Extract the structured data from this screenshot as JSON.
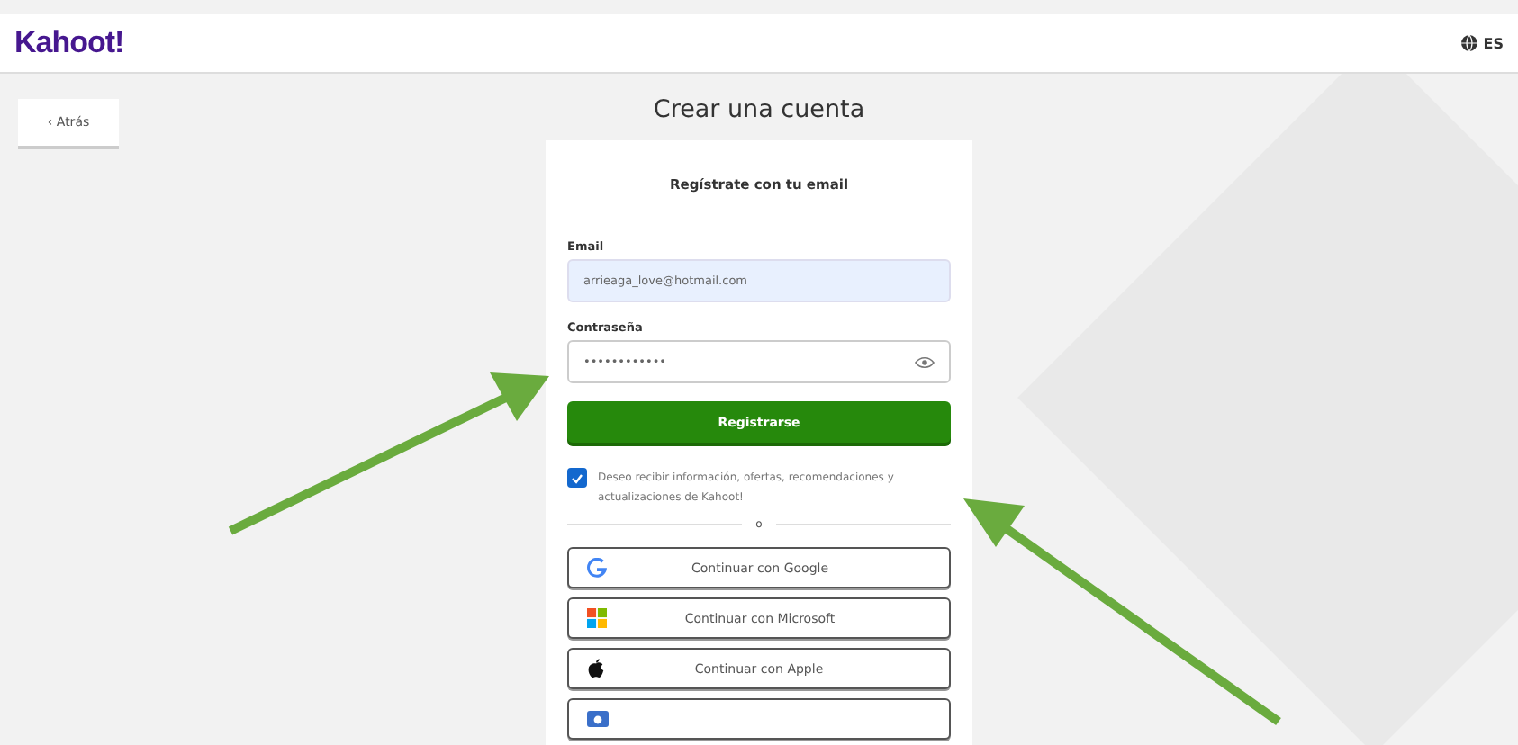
{
  "header": {
    "logo": "Kahoot!",
    "language": "ES"
  },
  "back_button": "‹ Atrás",
  "title": "Crear una cuenta",
  "form": {
    "heading": "Regístrate con tu email",
    "email": {
      "label": "Email",
      "value": "arrieaga_love@hotmail.com"
    },
    "password": {
      "label": "Contraseña",
      "value": "••••••••••••"
    },
    "submit": "Registrarse",
    "opt_in": {
      "text": "Deseo recibir información, ofertas, recomendaciones y actualizaciones de Kahoot!",
      "checked": true
    },
    "divider": "o",
    "social_buttons": [
      {
        "kind": "google",
        "label": "Continuar con Google"
      },
      {
        "kind": "microsoft",
        "label": "Continuar con Microsoft"
      },
      {
        "kind": "apple",
        "label": "Continuar con Apple"
      },
      {
        "kind": "other"
      }
    ]
  }
}
